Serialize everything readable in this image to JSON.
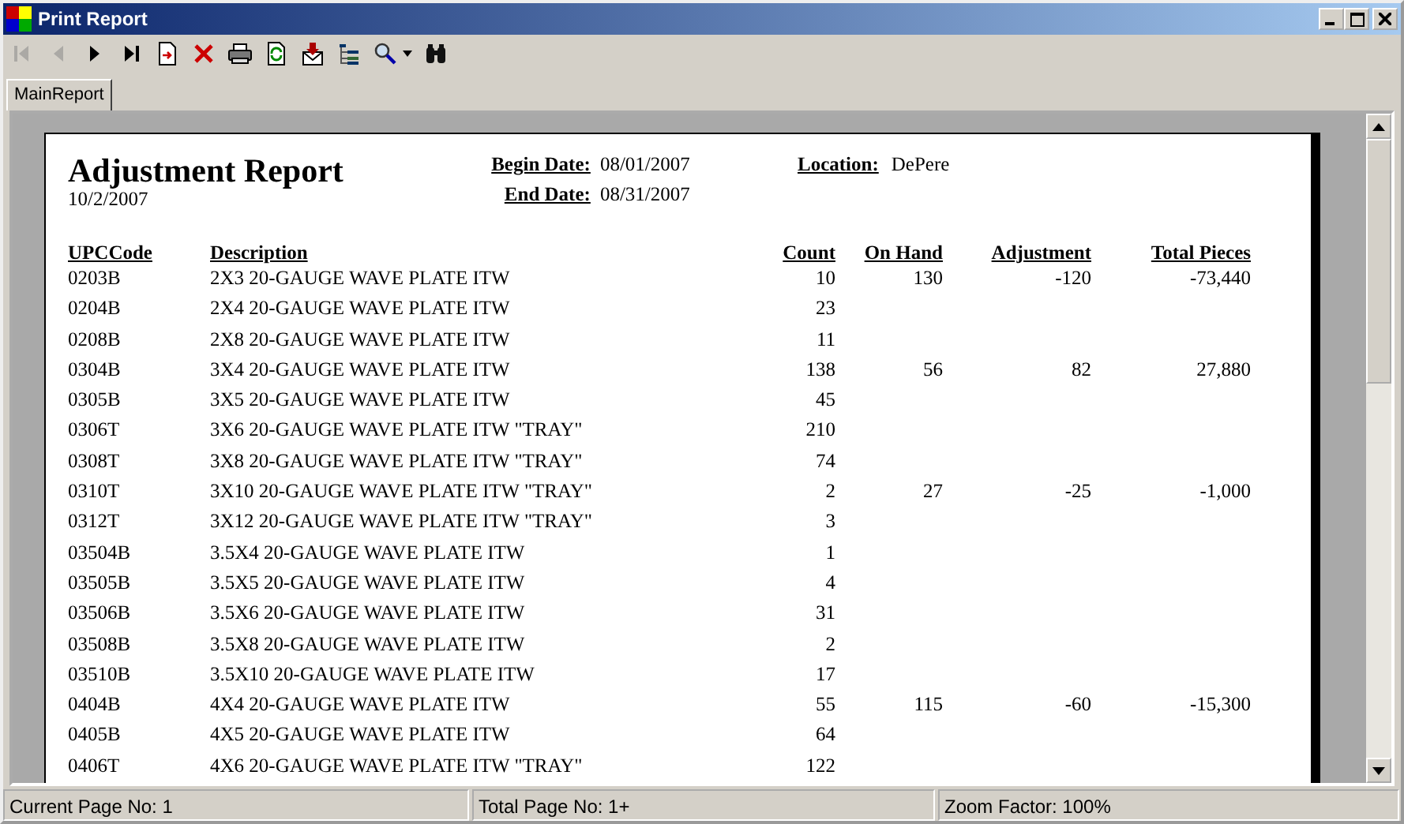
{
  "window": {
    "title": "Print Report"
  },
  "toolbar": [
    {
      "kind": "first",
      "disabled": true
    },
    {
      "kind": "prev",
      "disabled": true
    },
    {
      "kind": "next",
      "disabled": false
    },
    {
      "kind": "last",
      "disabled": false
    },
    {
      "kind": "goto",
      "disabled": false
    },
    {
      "kind": "stop",
      "disabled": false
    },
    {
      "kind": "print",
      "disabled": false
    },
    {
      "kind": "refresh",
      "disabled": false
    },
    {
      "kind": "export",
      "disabled": false
    },
    {
      "kind": "tree",
      "disabled": false
    },
    {
      "kind": "zoom",
      "disabled": false
    },
    {
      "kind": "find",
      "disabled": false
    }
  ],
  "tabs": [
    {
      "label": "MainReport",
      "selected": true
    }
  ],
  "report": {
    "title": "Adjustment Report",
    "date": "10/2/2007",
    "fields": [
      {
        "label": "Begin Date:",
        "value": "08/01/2007"
      },
      {
        "label": "End Date:",
        "value": "08/31/2007"
      },
      {
        "label": "Location:",
        "value": "DePere"
      }
    ],
    "columns": [
      "UPCCode",
      "Description",
      "Count",
      "On Hand",
      "Adjustment",
      "Total Pieces"
    ],
    "rows": [
      [
        "0203B",
        "2X3 20-GAUGE WAVE PLATE ITW",
        "10",
        "130",
        "-120",
        "-73,440"
      ],
      [
        "0204B",
        "2X4 20-GAUGE WAVE PLATE ITW",
        "23",
        "",
        "",
        ""
      ],
      [
        "0208B",
        "2X8 20-GAUGE WAVE PLATE ITW",
        "11",
        "",
        "",
        ""
      ],
      [
        "0304B",
        "3X4 20-GAUGE WAVE PLATE ITW",
        "138",
        "56",
        "82",
        "27,880"
      ],
      [
        "0305B",
        "3X5 20-GAUGE WAVE PLATE ITW",
        "45",
        "",
        "",
        ""
      ],
      [
        "0306T",
        "3X6 20-GAUGE WAVE PLATE ITW \"TRAY\"",
        "210",
        "",
        "",
        ""
      ],
      [
        "0308T",
        "3X8 20-GAUGE WAVE PLATE ITW \"TRAY\"",
        "74",
        "",
        "",
        ""
      ],
      [
        "0310T",
        "3X10 20-GAUGE WAVE PLATE ITW \"TRAY\"",
        "2",
        "27",
        "-25",
        "-1,000"
      ],
      [
        "0312T",
        "3X12 20-GAUGE WAVE PLATE ITW \"TRAY\"",
        "3",
        "",
        "",
        ""
      ],
      [
        "03504B",
        "3.5X4 20-GAUGE WAVE PLATE ITW",
        "1",
        "",
        "",
        ""
      ],
      [
        "03505B",
        "3.5X5 20-GAUGE WAVE PLATE ITW",
        "4",
        "",
        "",
        ""
      ],
      [
        "03506B",
        "3.5X6 20-GAUGE WAVE PLATE ITW",
        "31",
        "",
        "",
        ""
      ],
      [
        "03508B",
        "3.5X8 20-GAUGE WAVE PLATE ITW",
        "2",
        "",
        "",
        ""
      ],
      [
        "03510B",
        "3.5X10 20-GAUGE WAVE PLATE ITW",
        "17",
        "",
        "",
        ""
      ],
      [
        "0404B",
        "4X4 20-GAUGE WAVE PLATE ITW",
        "55",
        "115",
        "-60",
        "-15,300"
      ],
      [
        "0405B",
        "4X5 20-GAUGE WAVE PLATE ITW",
        "64",
        "",
        "",
        ""
      ],
      [
        "0406T",
        "4X6 20-GAUGE WAVE PLATE ITW \"TRAY\"",
        "122",
        "",
        "",
        ""
      ]
    ]
  },
  "status_bar": [
    "Current Page No: 1",
    "Total Page No: 1+",
    "Zoom Factor: 100%"
  ]
}
